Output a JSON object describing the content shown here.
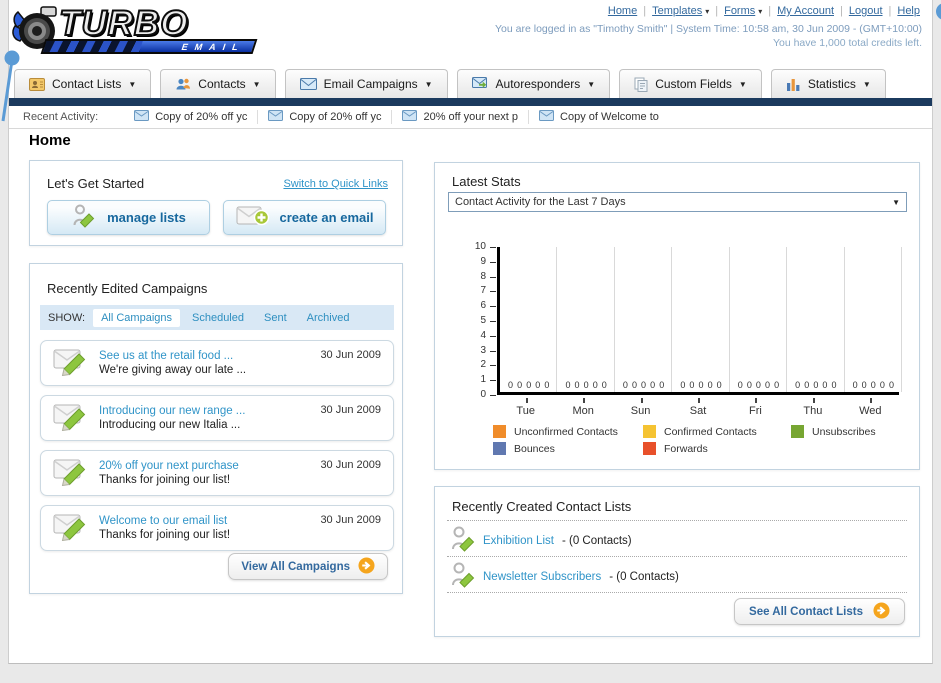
{
  "colors": {
    "navy_bar": "#1b3a5e",
    "header_link": "#33699e",
    "teal_link": "#3094c8",
    "button_text": "#17689e",
    "show_bar_bg": "#d9e8f5",
    "annotation_blue": "#5b9bd5"
  },
  "header": {
    "logo_title": "TURBO",
    "logo_subtitle": "EMAIL",
    "nav_links": [
      {
        "label": "Home",
        "dropdown": false
      },
      {
        "label": "Templates",
        "dropdown": true
      },
      {
        "label": "Forms",
        "dropdown": true
      },
      {
        "label": "My Account",
        "dropdown": false
      },
      {
        "label": "Logout",
        "dropdown": false
      },
      {
        "label": "Help",
        "dropdown": false
      }
    ],
    "login_status": "You are logged in as \"Timothy Smith\" | System Time: 10:58 am, 30 Jun 2009 - (GMT+10:00)",
    "credits_line": "You have 1,000 total credits left."
  },
  "nav_tabs": [
    {
      "label": "Contact Lists",
      "icon": "contact-lists-icon"
    },
    {
      "label": "Contacts",
      "icon": "contacts-icon"
    },
    {
      "label": "Email Campaigns",
      "icon": "email-campaigns-icon"
    },
    {
      "label": "Autoresponders",
      "icon": "autoresponders-icon"
    },
    {
      "label": "Custom Fields",
      "icon": "custom-fields-icon"
    },
    {
      "label": "Statistics",
      "icon": "statistics-icon"
    }
  ],
  "recent_activity": {
    "label": "Recent Activity:",
    "items": [
      "Copy of 20% off yc",
      "Copy of 20% off yc",
      "20% off your next p",
      "Copy of Welcome to"
    ]
  },
  "page_title": "Home",
  "get_started": {
    "title": "Let's Get Started",
    "switch_link": "Switch to Quick Links",
    "buttons": [
      {
        "label": "manage lists",
        "icon": "manage-lists-icon"
      },
      {
        "label": "create an email",
        "icon": "create-email-icon"
      }
    ]
  },
  "campaigns": {
    "title": "Recently Edited Campaigns",
    "show_label": "SHOW:",
    "filters": [
      "All Campaigns",
      "Scheduled",
      "Sent",
      "Archived"
    ],
    "active_filter": "All Campaigns",
    "items": [
      {
        "title": "See us at the retail food ...",
        "subtitle": "We're giving away our late ...",
        "date": "30 Jun 2009"
      },
      {
        "title": "Introducing our new range ...",
        "subtitle": "Introducing our new Italia ...",
        "date": "30 Jun 2009"
      },
      {
        "title": "20% off your next purchase",
        "subtitle": "Thanks for joining our list!",
        "date": "30 Jun 2009"
      },
      {
        "title": "Welcome to our email list",
        "subtitle": "Thanks for joining our list!",
        "date": "30 Jun 2009"
      }
    ],
    "view_all_label": "View All Campaigns"
  },
  "latest_stats": {
    "title": "Latest Stats",
    "dropdown_value": "Contact Activity for the Last 7 Days"
  },
  "chart_data": {
    "type": "bar",
    "categories": [
      "Tue",
      "Mon",
      "Sun",
      "Sat",
      "Fri",
      "Thu",
      "Wed"
    ],
    "series": [
      {
        "name": "Unconfirmed Contacts",
        "color": "#f08c2a",
        "values": [
          0,
          0,
          0,
          0,
          0,
          0,
          0
        ]
      },
      {
        "name": "Confirmed Contacts",
        "color": "#f5c332",
        "values": [
          0,
          0,
          0,
          0,
          0,
          0,
          0
        ]
      },
      {
        "name": "Unsubscribes",
        "color": "#77a632",
        "values": [
          0,
          0,
          0,
          0,
          0,
          0,
          0
        ]
      },
      {
        "name": "Bounces",
        "color": "#6078b0",
        "values": [
          0,
          0,
          0,
          0,
          0,
          0,
          0
        ]
      },
      {
        "name": "Forwards",
        "color": "#e8502a",
        "values": [
          0,
          0,
          0,
          0,
          0,
          0,
          0
        ]
      }
    ],
    "title": "Contact Activity for the Last 7 Days",
    "xlabel": "",
    "ylabel": "",
    "ylim": [
      0,
      10
    ],
    "yticks": [
      0,
      1,
      2,
      3,
      4,
      5,
      6,
      7,
      8,
      9,
      10
    ],
    "grid": true,
    "legend_position": "bottom",
    "data_labels": "each bar shows 0"
  },
  "contact_lists": {
    "title": "Recently Created Contact Lists",
    "items": [
      {
        "name": "Exhibition List",
        "detail": "- (0 Contacts)"
      },
      {
        "name": "Newsletter Subscribers",
        "detail": "- (0 Contacts)"
      }
    ],
    "see_all_label": "See All Contact Lists"
  }
}
